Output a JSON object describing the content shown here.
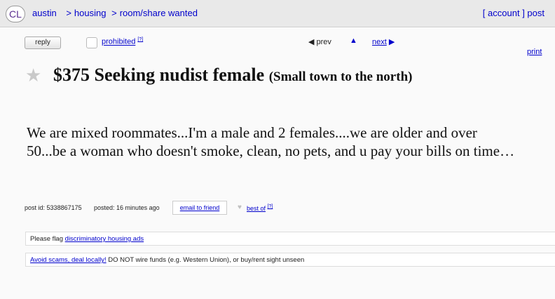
{
  "header": {
    "logo": "CL",
    "city": "austin",
    "breadcrumbs": [
      "housing",
      "room/share wanted"
    ],
    "account": "account",
    "post": "post"
  },
  "toolbar": {
    "reply": "reply",
    "prohibited": "prohibited",
    "prohibited_sup": "[?]",
    "prev": "prev",
    "up": "▲",
    "next": "next",
    "print": "print"
  },
  "posting": {
    "price": "$375",
    "title": "Seeking nudist female",
    "location": "(Small town to the north)",
    "body": "We are mixed roommates...I'm a male and 2 females....we are older and over 50...be a woman who doesn't smoke, clean, no pets, and u pay your bills on time…"
  },
  "postinfo": {
    "post_id_label": "post id:",
    "post_id": "5338867175",
    "posted_label": "posted:",
    "posted_value": "16 minutes ago",
    "email_friend": "email to friend",
    "best_of": "best of",
    "best_of_sup": "[?]"
  },
  "notices": {
    "flag_prefix": "Please flag",
    "flag_link": "discriminatory housing ads",
    "scam_link": "Avoid scams, deal locally!",
    "scam_text": "DO NOT wire funds (e.g. Western Union), or buy/rent sight unseen"
  },
  "icons": {
    "star": "star-icon",
    "prev": "triangle-left-icon",
    "next": "triangle-right-icon",
    "heart": "heart-icon"
  },
  "colors": {
    "link": "#0000cc",
    "topbar": "#e9e9e9",
    "logo": "#5b2e91"
  }
}
